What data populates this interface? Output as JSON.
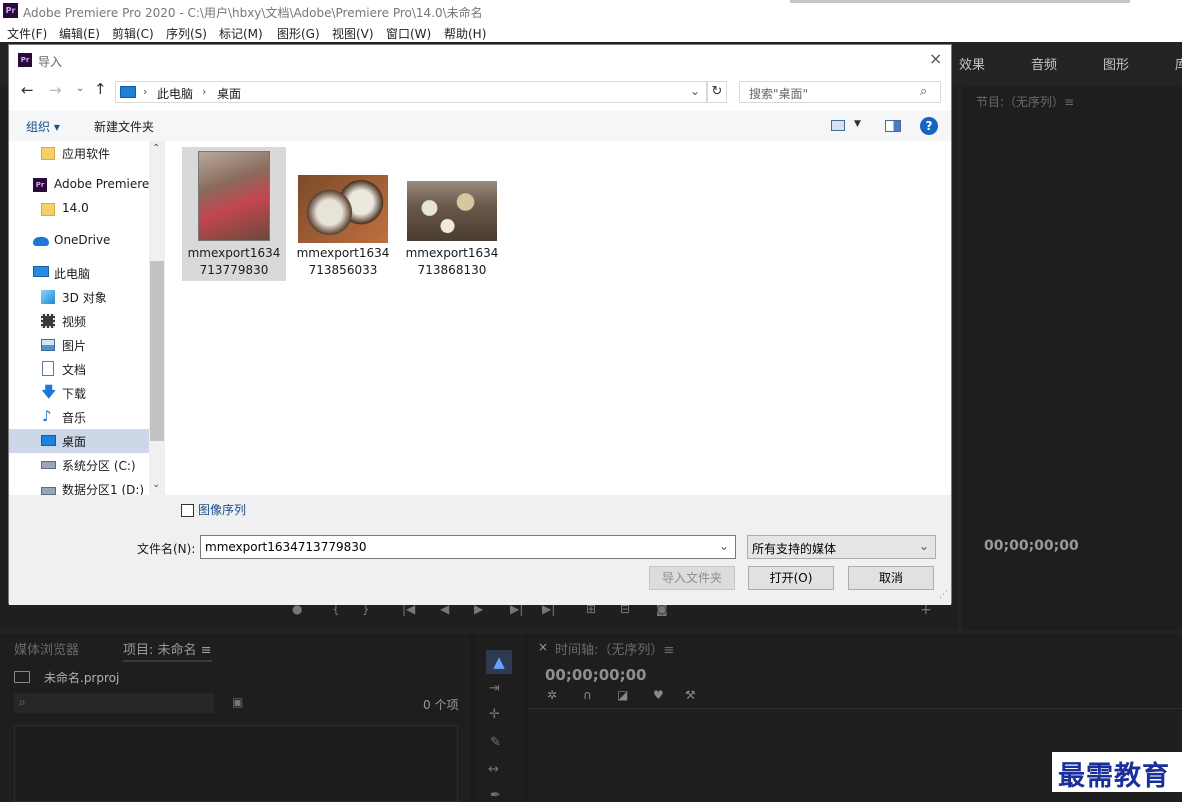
{
  "app": {
    "title": "Adobe Premiere Pro 2020 - C:\\用户\\hbxy\\文档\\Adobe\\Premiere Pro\\14.0\\未命名",
    "logo": "Pr",
    "menu": [
      "文件(F)",
      "编辑(E)",
      "剪辑(C)",
      "序列(S)",
      "标记(M)",
      "图形(G)",
      "视图(V)",
      "窗口(W)",
      "帮助(H)"
    ]
  },
  "premiere": {
    "workspace_tabs": [
      "效果",
      "音频",
      "图形",
      "库"
    ],
    "program_label": "节目:（无序列）≡",
    "program_timecode": "00;00;00;00",
    "media_browser_tab": "媒体浏览器",
    "project_tab": "项目: 未命名 ≡",
    "project_file": "未命名.prproj",
    "item_count": "0 个项",
    "timeline_tab": "时间轴:（无序列）≡",
    "timeline_timecode": "00;00;00;00",
    "close_mark": "×"
  },
  "dialog": {
    "title": "导入",
    "close": "×",
    "breadcrumb": [
      "此电脑",
      "桌面"
    ],
    "search_placeholder": "搜索\"桌面\"",
    "organize": "组织 ▾",
    "new_folder": "新建文件夹",
    "help": "?",
    "nav_items": [
      {
        "label": "应用软件",
        "icon": "folder-icon"
      },
      {
        "label": "Adobe Premiere",
        "icon": "premiere-icon"
      },
      {
        "label": "14.0",
        "icon": "folder-icon"
      },
      {
        "label": "OneDrive",
        "icon": "cloud-icon"
      },
      {
        "label": "此电脑",
        "icon": "computer-icon"
      },
      {
        "label": "3D 对象",
        "icon": "cube-icon"
      },
      {
        "label": "视频",
        "icon": "film-icon"
      },
      {
        "label": "图片",
        "icon": "picture-icon"
      },
      {
        "label": "文档",
        "icon": "document-icon"
      },
      {
        "label": "下载",
        "icon": "download-icon"
      },
      {
        "label": "音乐",
        "icon": "music-icon"
      },
      {
        "label": "桌面",
        "icon": "desktop-icon"
      },
      {
        "label": "系统分区 (C:)",
        "icon": "drive-icon"
      },
      {
        "label": "数据分区1 (D:)",
        "icon": "drive-icon"
      }
    ],
    "files": [
      {
        "line1": "mmexport1634",
        "line2": "713779830"
      },
      {
        "line1": "mmexport1634",
        "line2": "713856033"
      },
      {
        "line1": "mmexport1634",
        "line2": "713868130"
      }
    ],
    "image_sequence": "图像序列",
    "filename_label": "文件名(N):",
    "filename_value": "mmexport1634713779830",
    "filetype": "所有支持的媒体",
    "import_folder": "导入文件夹",
    "open": "打开(O)",
    "cancel": "取消"
  },
  "watermark": "最需教育"
}
